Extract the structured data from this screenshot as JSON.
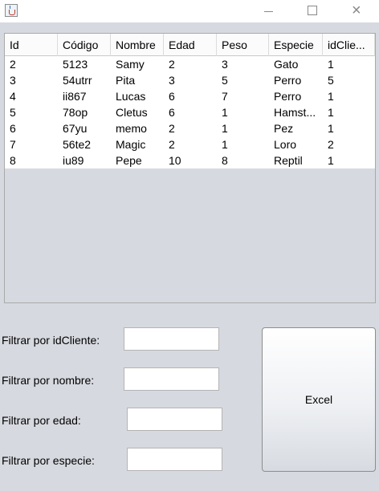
{
  "window": {
    "minimize_glyph": "",
    "maximize_glyph": "",
    "close_glyph": "×"
  },
  "table": {
    "columns": [
      "Id",
      "Código",
      "Nombre",
      "Edad",
      "Peso",
      "Especie",
      "idClie..."
    ],
    "rows": [
      [
        "2",
        "5123",
        "Samy",
        "2",
        "3",
        "Gato",
        "1"
      ],
      [
        "3",
        "54utrr",
        "Pita",
        "3",
        "5",
        "Perro",
        "5"
      ],
      [
        "4",
        "ii867",
        "Lucas",
        "6",
        "7",
        "Perro",
        "1"
      ],
      [
        "5",
        "78op",
        "Cletus",
        "6",
        "1",
        "Hamst...",
        "1"
      ],
      [
        "6",
        "67yu",
        "memo",
        "2",
        "1",
        "Pez",
        "1"
      ],
      [
        "7",
        "56te2",
        "Magic",
        "2",
        "1",
        "Loro",
        "2"
      ],
      [
        "8",
        "iu89",
        "Pepe",
        "10",
        "8",
        "Reptil",
        "1"
      ]
    ]
  },
  "filters": {
    "idcliente_label": "Filtrar por idCliente:",
    "idcliente_value": "",
    "nombre_label": "Filtrar por nombre:",
    "nombre_value": "",
    "edad_label": "Filtrar por edad:",
    "edad_value": "",
    "especie_label": "Filtrar por especie:",
    "especie_value": ""
  },
  "excel_button_label": "Excel",
  "colors": {
    "window_background": "#d6d9df",
    "table_background": "#ffffff",
    "border": "#a9a9a9"
  },
  "icons": {
    "app": "java-coffee-cup-icon",
    "minimize": "minimize-icon",
    "maximize": "maximize-icon",
    "close": "close-icon"
  }
}
